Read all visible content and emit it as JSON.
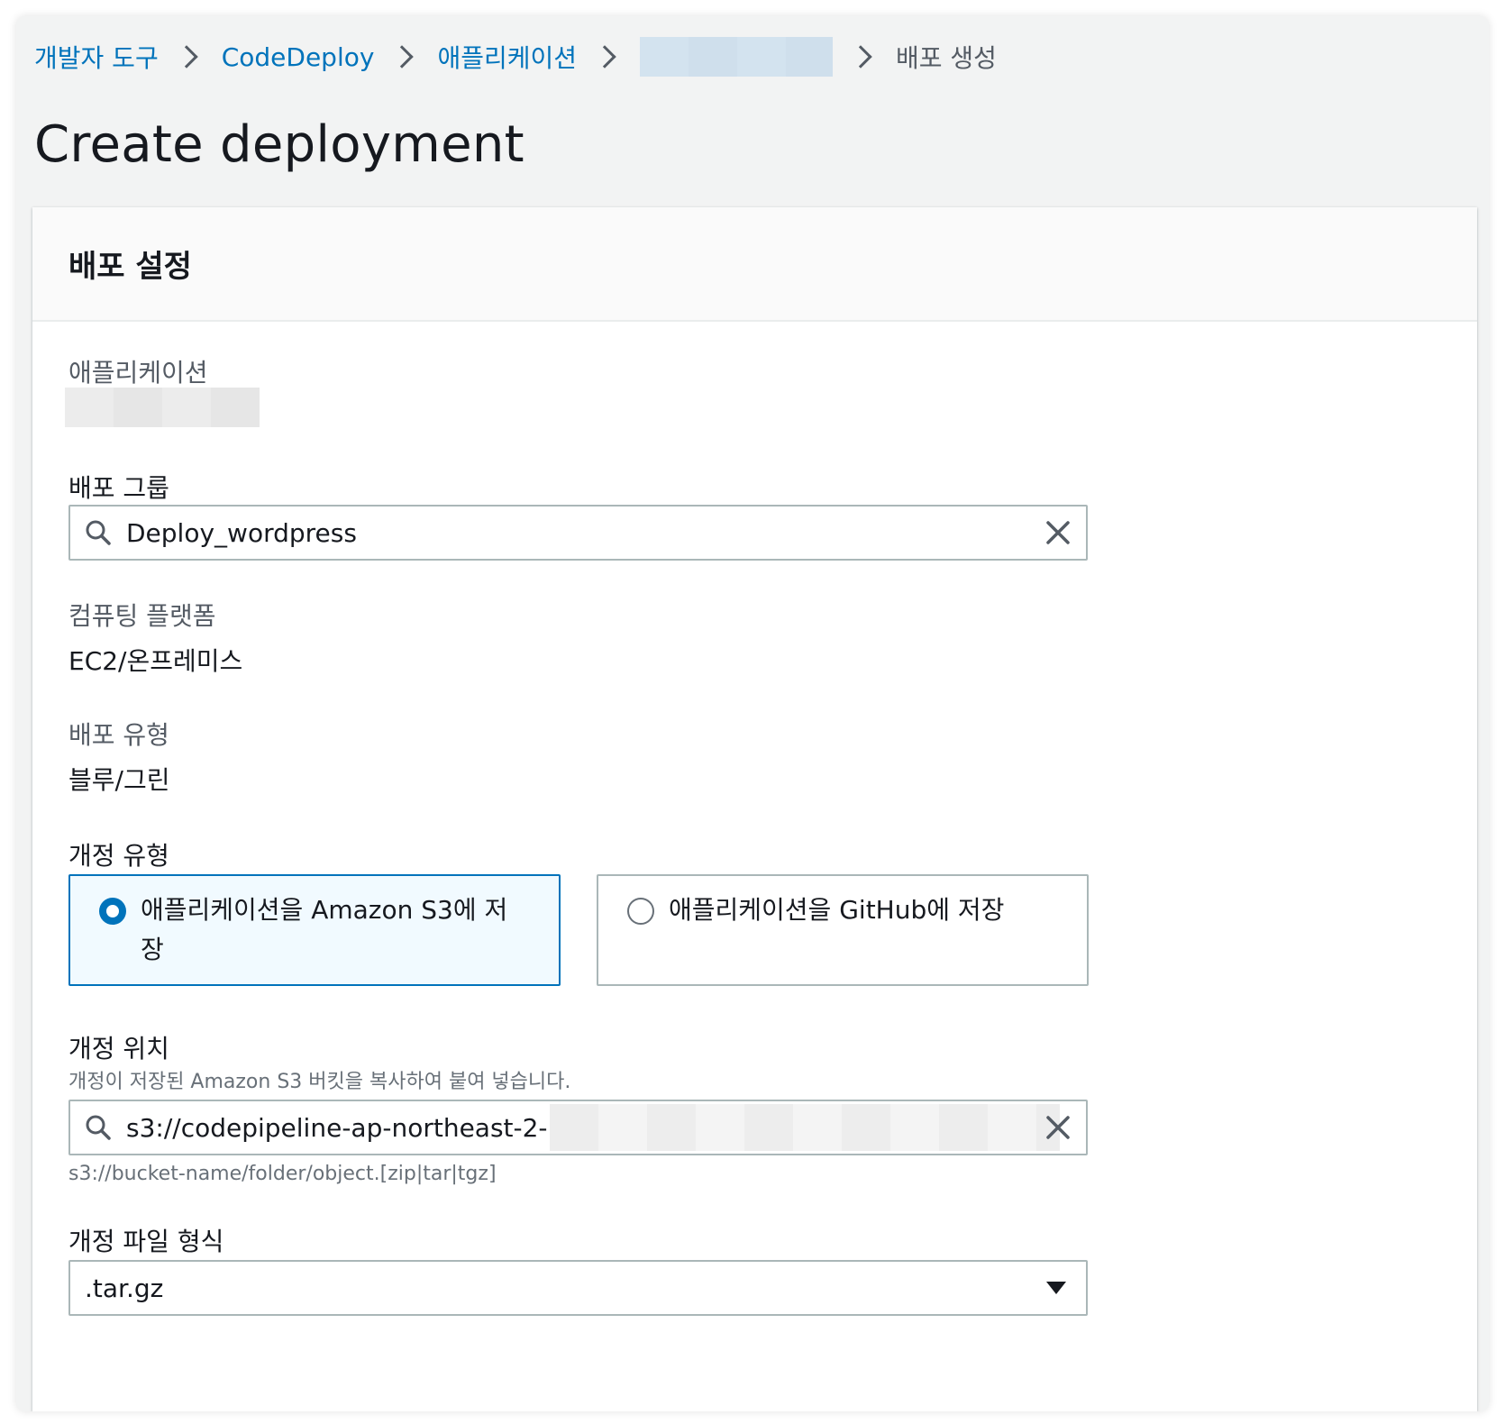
{
  "breadcrumb": {
    "items": [
      "개발자 도구",
      "CodeDeploy",
      "애플리케이션"
    ],
    "current": "배포 생성"
  },
  "page_title": "Create deployment",
  "panel": {
    "title": "배포 설정",
    "application": {
      "label": "애플리케이션"
    },
    "deployment_group": {
      "label": "배포 그룹",
      "value": "Deploy_wordpress"
    },
    "compute_platform": {
      "label": "컴퓨팅 플랫폼",
      "value": "EC2/온프레미스"
    },
    "deployment_type": {
      "label": "배포 유형",
      "value": "블루/그린"
    },
    "revision_type": {
      "label": "개정 유형",
      "options": [
        {
          "label": "애플리케이션을 Amazon S3에 저장",
          "selected": true
        },
        {
          "label": "애플리케이션을 GitHub에 저장",
          "selected": false
        }
      ]
    },
    "revision_location": {
      "label": "개정 위치",
      "description": "개정이 저장된 Amazon S3 버킷을 복사하여 붙여 넣습니다.",
      "value": "s3://codepipeline-ap-northeast-2-",
      "constraint": "s3://bucket-name/folder/object.[zip|tar|tgz]"
    },
    "revision_file_type": {
      "label": "개정 파일 형식",
      "value": ".tar.gz"
    }
  },
  "colors": {
    "link": "#0073bb",
    "background": "#f2f3f3",
    "selected_tile": "#f1faff"
  },
  "icons": {
    "search": "search-icon",
    "clear": "close-icon",
    "breadcrumb_separator": "chevron-right-icon",
    "select": "caret-down-icon"
  }
}
